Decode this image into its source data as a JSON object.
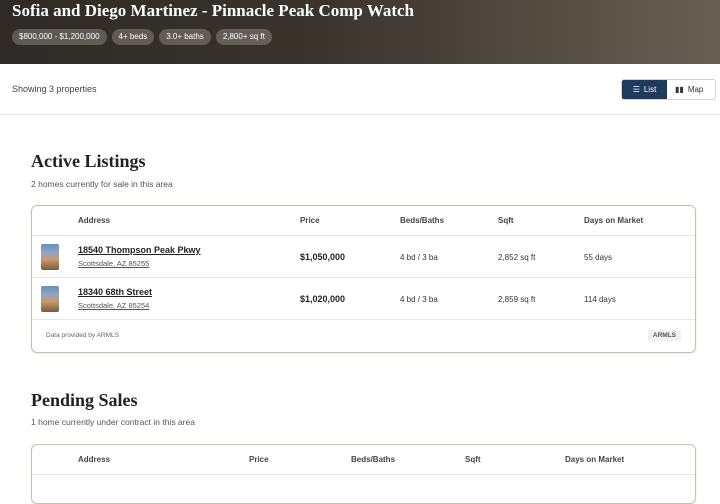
{
  "header": {
    "title": "Sofia and Diego Martinez - Pinnacle Peak Comp Watch",
    "filters": [
      "$800,000 - $1,200,000",
      "4+ beds",
      "3.0+ baths",
      "2,800+ sq ft"
    ]
  },
  "toolbar": {
    "showing": "Showing 3 properties",
    "list_label": "List",
    "map_label": "Map",
    "active_view": "List"
  },
  "active": {
    "title": "Active Listings",
    "subtitle": "2 homes currently for sale in this area",
    "columns": [
      "Address",
      "Price",
      "Beds/Baths",
      "Sqft",
      "Days on Market"
    ],
    "rows": [
      {
        "address": "18540 Thompson Peak Pkwy",
        "city": "Scottsdale, AZ 85255",
        "price": "$1,050,000",
        "beds_baths": "4 bd / 3 ba",
        "sqft": "2,852 sq ft",
        "dom": "55 days"
      },
      {
        "address": "18340 68th Street",
        "city": "Scottsdale, AZ 85254",
        "price": "$1,020,000",
        "beds_baths": "4 bd / 3 ba",
        "sqft": "2,859 sq ft",
        "dom": "114 days"
      }
    ],
    "provider": "Data provided by ARMLS",
    "badge": "ARMLS"
  },
  "pending": {
    "title": "Pending Sales",
    "subtitle": "1 home currently under contract in this area",
    "columns": [
      "Address",
      "Price",
      "Beds/Baths",
      "Sqft",
      "Days on Market"
    ]
  },
  "colors": {
    "accent": "#1f3a5f",
    "card_border": "#c8bfae"
  }
}
